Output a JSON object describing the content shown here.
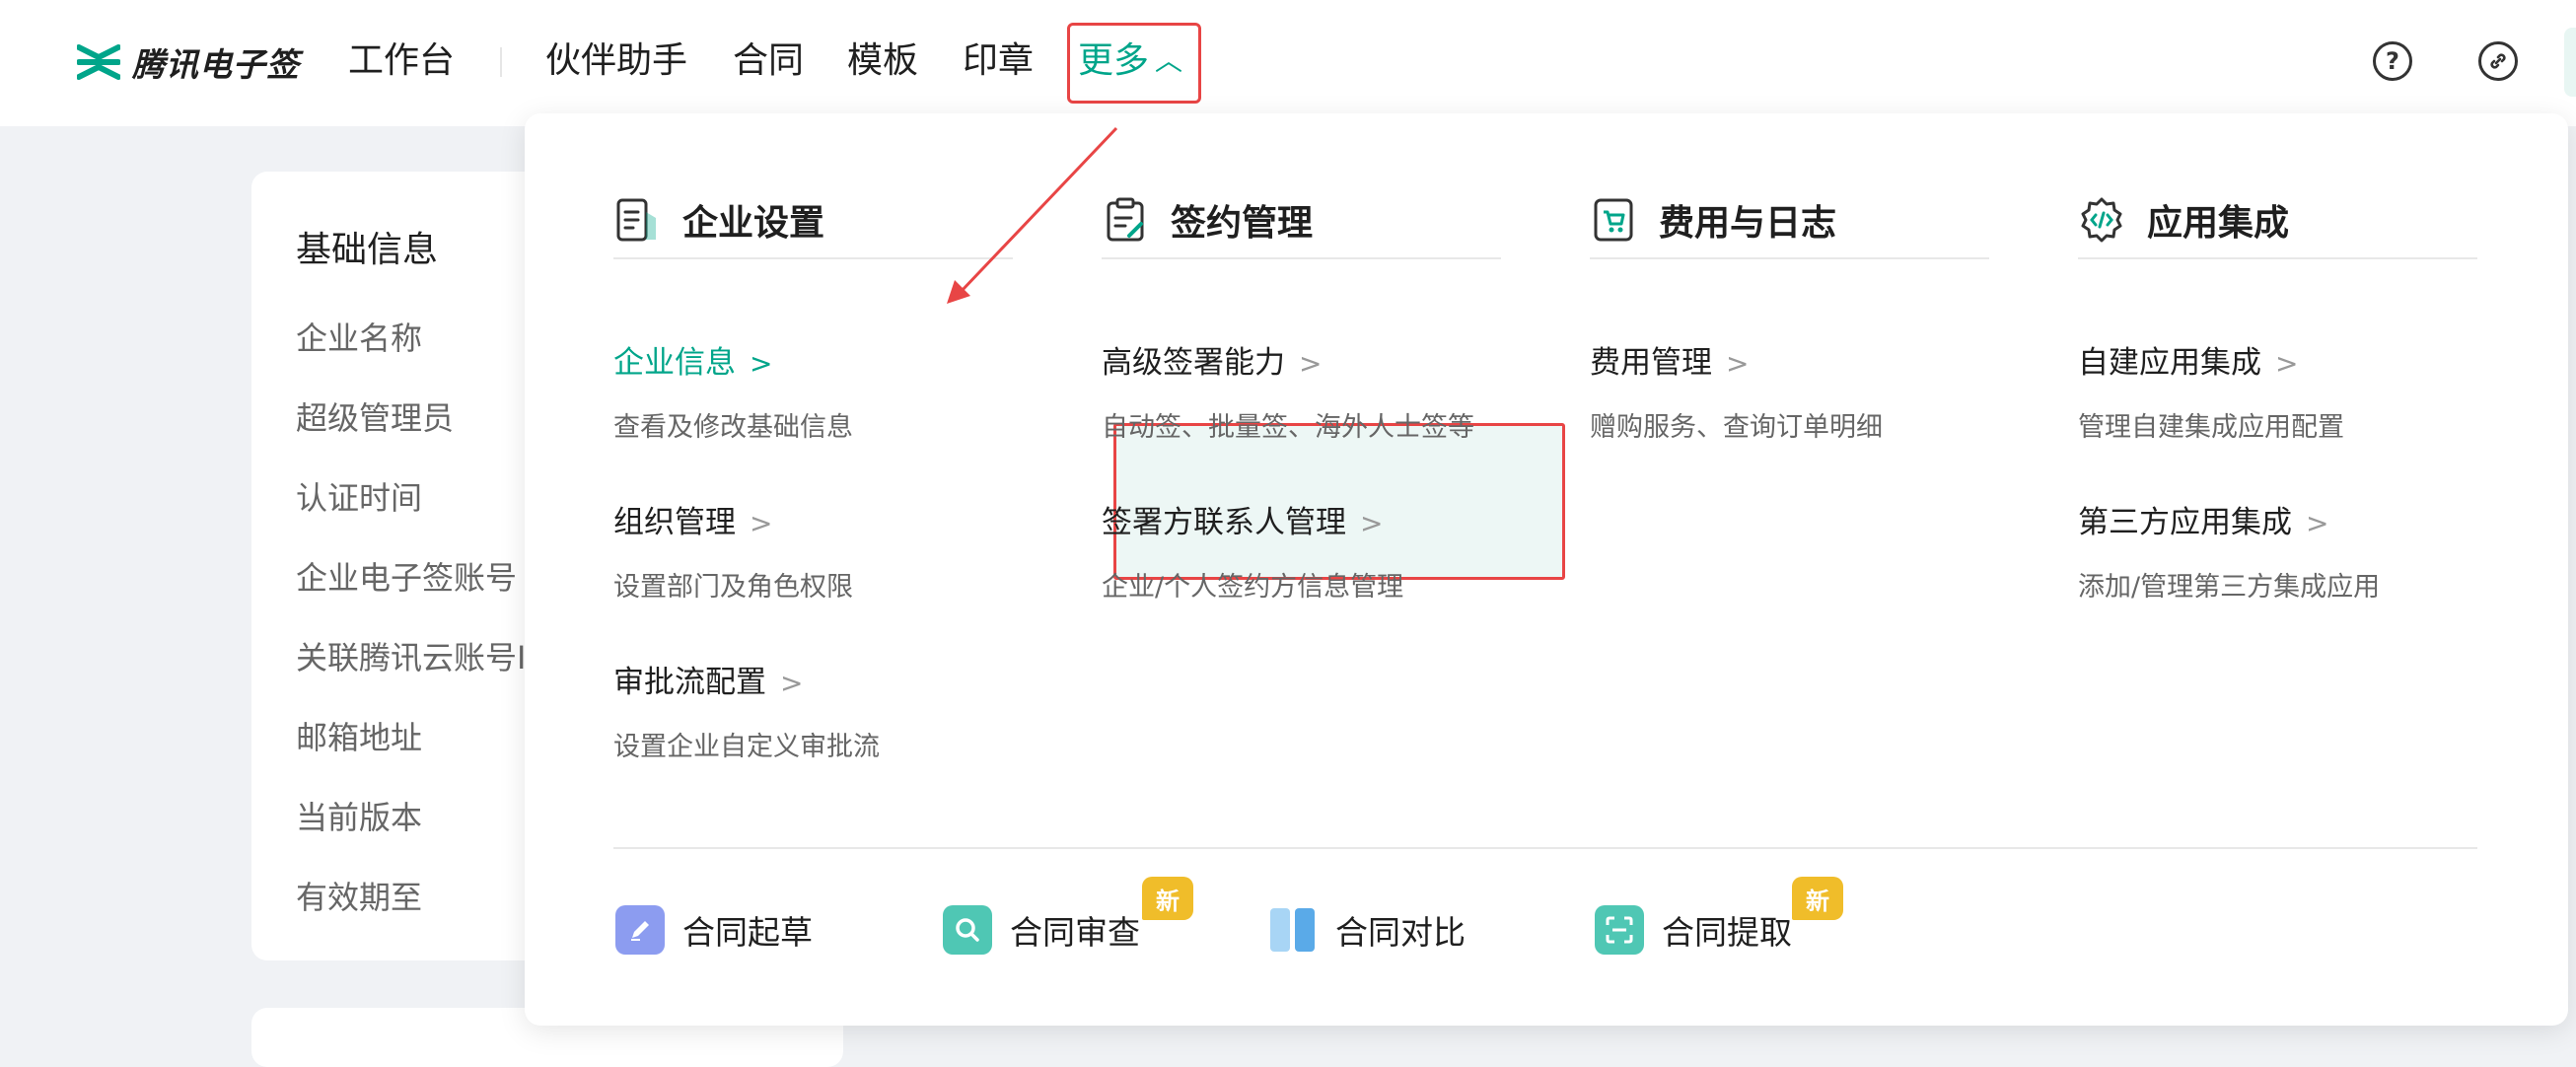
{
  "brand": {
    "name": "腾讯电子签",
    "color": "#00a58a",
    "logo_icon": "tencent-esign-logo-icon"
  },
  "nav": {
    "items": [
      "工作台",
      "伙伴助手",
      "合同",
      "模板",
      "印章"
    ],
    "more": "更多"
  },
  "header_icons": [
    "help-circle-icon",
    "link-icon"
  ],
  "info_card": {
    "title": "基础信息",
    "rows": [
      "企业名称",
      "超级管理员",
      "认证时间",
      "企业电子签账号",
      "关联腾讯云账号I",
      "邮箱地址",
      "当前版本",
      "有效期至"
    ]
  },
  "menu": {
    "columns": [
      {
        "title": "企业设置",
        "icon": "document-icon",
        "items": [
          {
            "title": "企业信息",
            "desc": "查看及修改基础信息",
            "active": true
          },
          {
            "title": "组织管理",
            "desc": "设置部门及角色权限"
          },
          {
            "title": "审批流配置",
            "desc": "设置企业自定义审批流"
          }
        ]
      },
      {
        "title": "签约管理",
        "icon": "clipboard-icon",
        "items": [
          {
            "title": "高级签署能力",
            "desc": "自动签、批量签、海外人士签等"
          },
          {
            "title": "签署方联系人管理",
            "desc": "企业/个人签约方信息管理"
          }
        ]
      },
      {
        "title": "费用与日志",
        "icon": "cart-icon",
        "items": [
          {
            "title": "费用管理",
            "desc": "赠购服务、查询订单明细"
          }
        ]
      },
      {
        "title": "应用集成",
        "icon": "code-gear-icon",
        "items": [
          {
            "title": "自建应用集成",
            "desc": "管理自建集成应用配置"
          },
          {
            "title": "第三方应用集成",
            "desc": "添加/管理第三方集成应用"
          }
        ]
      }
    ],
    "tools": [
      {
        "label": "合同起草",
        "icon": "pen-icon",
        "color": "#8c9cf0"
      },
      {
        "label": "合同审查",
        "icon": "magnifier-icon",
        "color": "#4fc7b4",
        "badge": "新"
      },
      {
        "label": "合同对比",
        "icon": "compare-icon",
        "color": "#5aaae8"
      },
      {
        "label": "合同提取",
        "icon": "scan-icon",
        "color": "#4fc7b4",
        "badge": "新"
      }
    ]
  },
  "colors": {
    "accent": "#00a58a",
    "annotation_red": "#e84545",
    "badge": "#f0bd2a"
  }
}
